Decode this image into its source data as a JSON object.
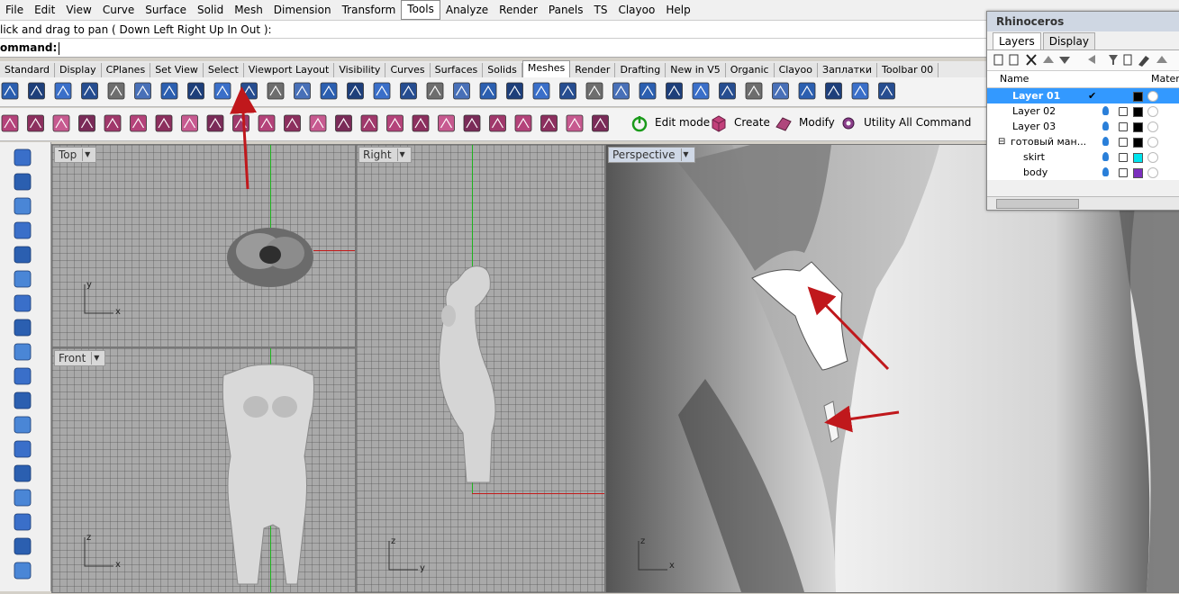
{
  "menu": [
    "File",
    "Edit",
    "View",
    "Curve",
    "Surface",
    "Solid",
    "Mesh",
    "Dimension",
    "Transform",
    "Tools",
    "Analyze",
    "Render",
    "Panels",
    "TS",
    "Clayoo",
    "Help"
  ],
  "active_menu": "Tools",
  "command_history": "lick and drag to pan ( Down  Left  Right  Up  In  Out ):",
  "command_prompt": "ommand:",
  "tabs": [
    "Standard",
    "Display",
    "CPlanes",
    "Set View",
    "Select",
    "Viewport Layout",
    "Visibility",
    "Curves",
    "Surfaces",
    "Solids",
    "Meshes",
    "Render",
    "Drafting",
    "New in V5",
    "Organic",
    "Clayoo",
    "Заплатки",
    "Toolbar 00"
  ],
  "active_tab": "Meshes",
  "toolbar2_labels": {
    "edit_mode": "Edit mode",
    "create": "Create",
    "modify": "Modify",
    "utility": "Utility",
    "all_command": "All Command"
  },
  "viewports": {
    "top": "Top",
    "right": "Right",
    "front": "Front",
    "perspective": "Perspective"
  },
  "axis_letters": {
    "x": "x",
    "y": "y",
    "z": "z"
  },
  "layers_panel": {
    "title": "Rhinoceros",
    "tabs": [
      "Layers",
      "Display"
    ],
    "col_name": "Name",
    "col_material": "Materia",
    "rows": [
      {
        "name": "Layer 01",
        "color": "#000000",
        "current": true
      },
      {
        "name": "Layer 02",
        "color": "#000000"
      },
      {
        "name": "Layer 03",
        "color": "#000000"
      },
      {
        "name": "готовый ман...",
        "color": "#000000"
      },
      {
        "name": "skirt",
        "color": "#00e5ee"
      },
      {
        "name": "body",
        "color": "#7b2fbe"
      }
    ]
  },
  "colors": {
    "accent": "#3399ff",
    "axis_x": "#c41a1a",
    "axis_y": "#1db41d",
    "arrow": "#c0181c"
  }
}
